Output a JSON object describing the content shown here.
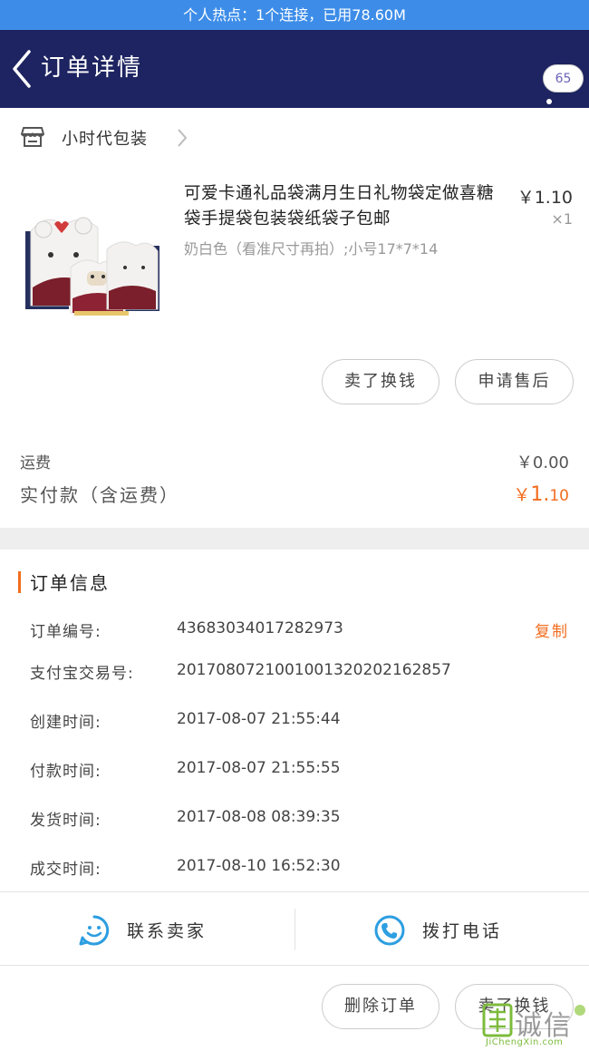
{
  "hotspot": "个人热点：1个连接，已用78.60M",
  "header": {
    "title": "订单详情",
    "badge": "65",
    "brand_color": "#1e2461"
  },
  "shop": {
    "name": "小时代包装"
  },
  "product": {
    "title": "可爱卡通礼品袋满月生日礼物袋定做喜糖袋手提袋包装袋纸袋子包邮",
    "sku": "奶白色（看准尺寸再拍）;小号17*7*14",
    "price": "￥1.10",
    "quantity": "×1",
    "buttons": [
      "卖了换钱",
      "申请售后"
    ]
  },
  "fees": {
    "shipping_label": "运费",
    "shipping_value": "￥0.00",
    "paid_label": "实付款（含运费）",
    "paid_currency": "￥",
    "paid_int": "1.",
    "paid_dec": "10",
    "accent_color": "#f26d1f"
  },
  "order_info": {
    "title": "订单信息",
    "copy_label": "复制",
    "rows": [
      {
        "label": "订单编号:",
        "value": "43683034017282973"
      },
      {
        "label": "支付宝交易号:",
        "value": "20170807210010013202021628​57"
      },
      {
        "label": "创建时间:",
        "value": "2017-08-07 21:55:44"
      },
      {
        "label": "付款时间:",
        "value": "2017-08-07 21:55:55"
      },
      {
        "label": "发货时间:",
        "value": "2017-08-08 08:39:35"
      },
      {
        "label": "成交时间:",
        "value": "2017-08-10 16:52:30"
      }
    ]
  },
  "contact": {
    "seller": "联系卖家",
    "call": "拨打电话",
    "icon_color": "#2d9ee0"
  },
  "footer": {
    "buttons": [
      "删除订单",
      "卖了换钱"
    ]
  },
  "watermark": {
    "text_cn": "诚信",
    "text_en": "JiChengXin.com"
  }
}
